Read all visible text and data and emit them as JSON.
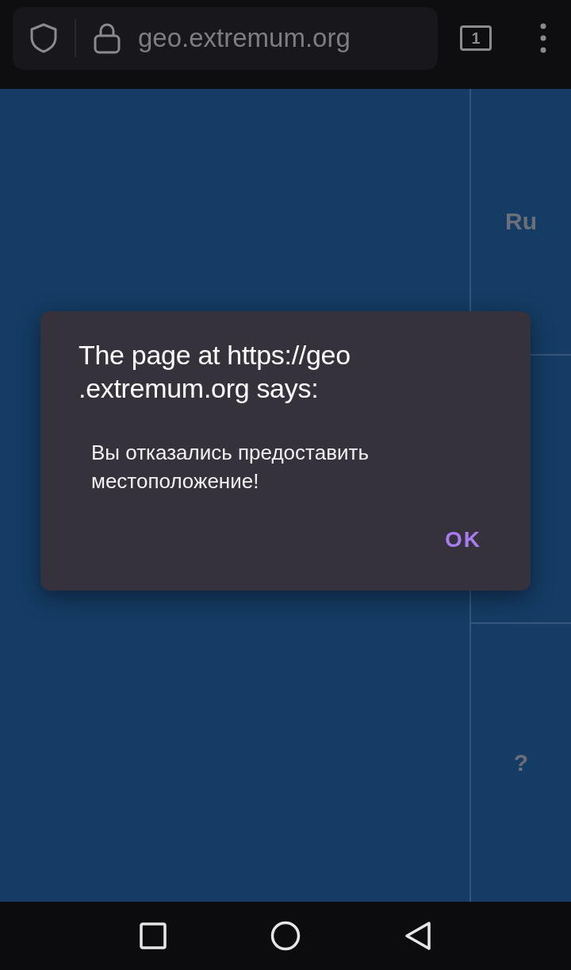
{
  "browser": {
    "url": "geo.extremum.org",
    "tab_count": "1"
  },
  "side_panel": {
    "top_label": "Ru",
    "bottom_label": "?"
  },
  "dialog": {
    "title_lines": [
      "The page at https://geo",
      ".extremum.org says:"
    ],
    "message": "Вы отказались предоставить местоположение!",
    "button": "OK"
  }
}
